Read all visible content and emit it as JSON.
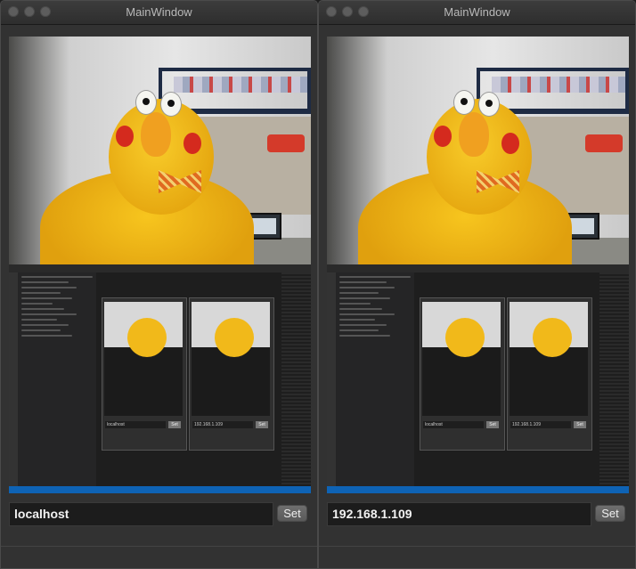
{
  "windows": [
    {
      "title": "MainWindow",
      "host_value": "localhost",
      "set_label": "Set",
      "capture": {
        "mini_left_value": "localhost",
        "mini_right_value": "192.168.1.109",
        "mini_set_label": "Set"
      }
    },
    {
      "title": "MainWindow",
      "host_value": "192.168.1.109",
      "set_label": "Set",
      "capture": {
        "mini_left_value": "localhost",
        "mini_right_value": "192.168.1.109",
        "mini_set_label": "Set"
      }
    }
  ],
  "colors": {
    "window_bg": "#323232",
    "field_bg": "#1c1c1c",
    "status_bar": "#0e63b5",
    "chick_yellow": "#f7c51e"
  }
}
